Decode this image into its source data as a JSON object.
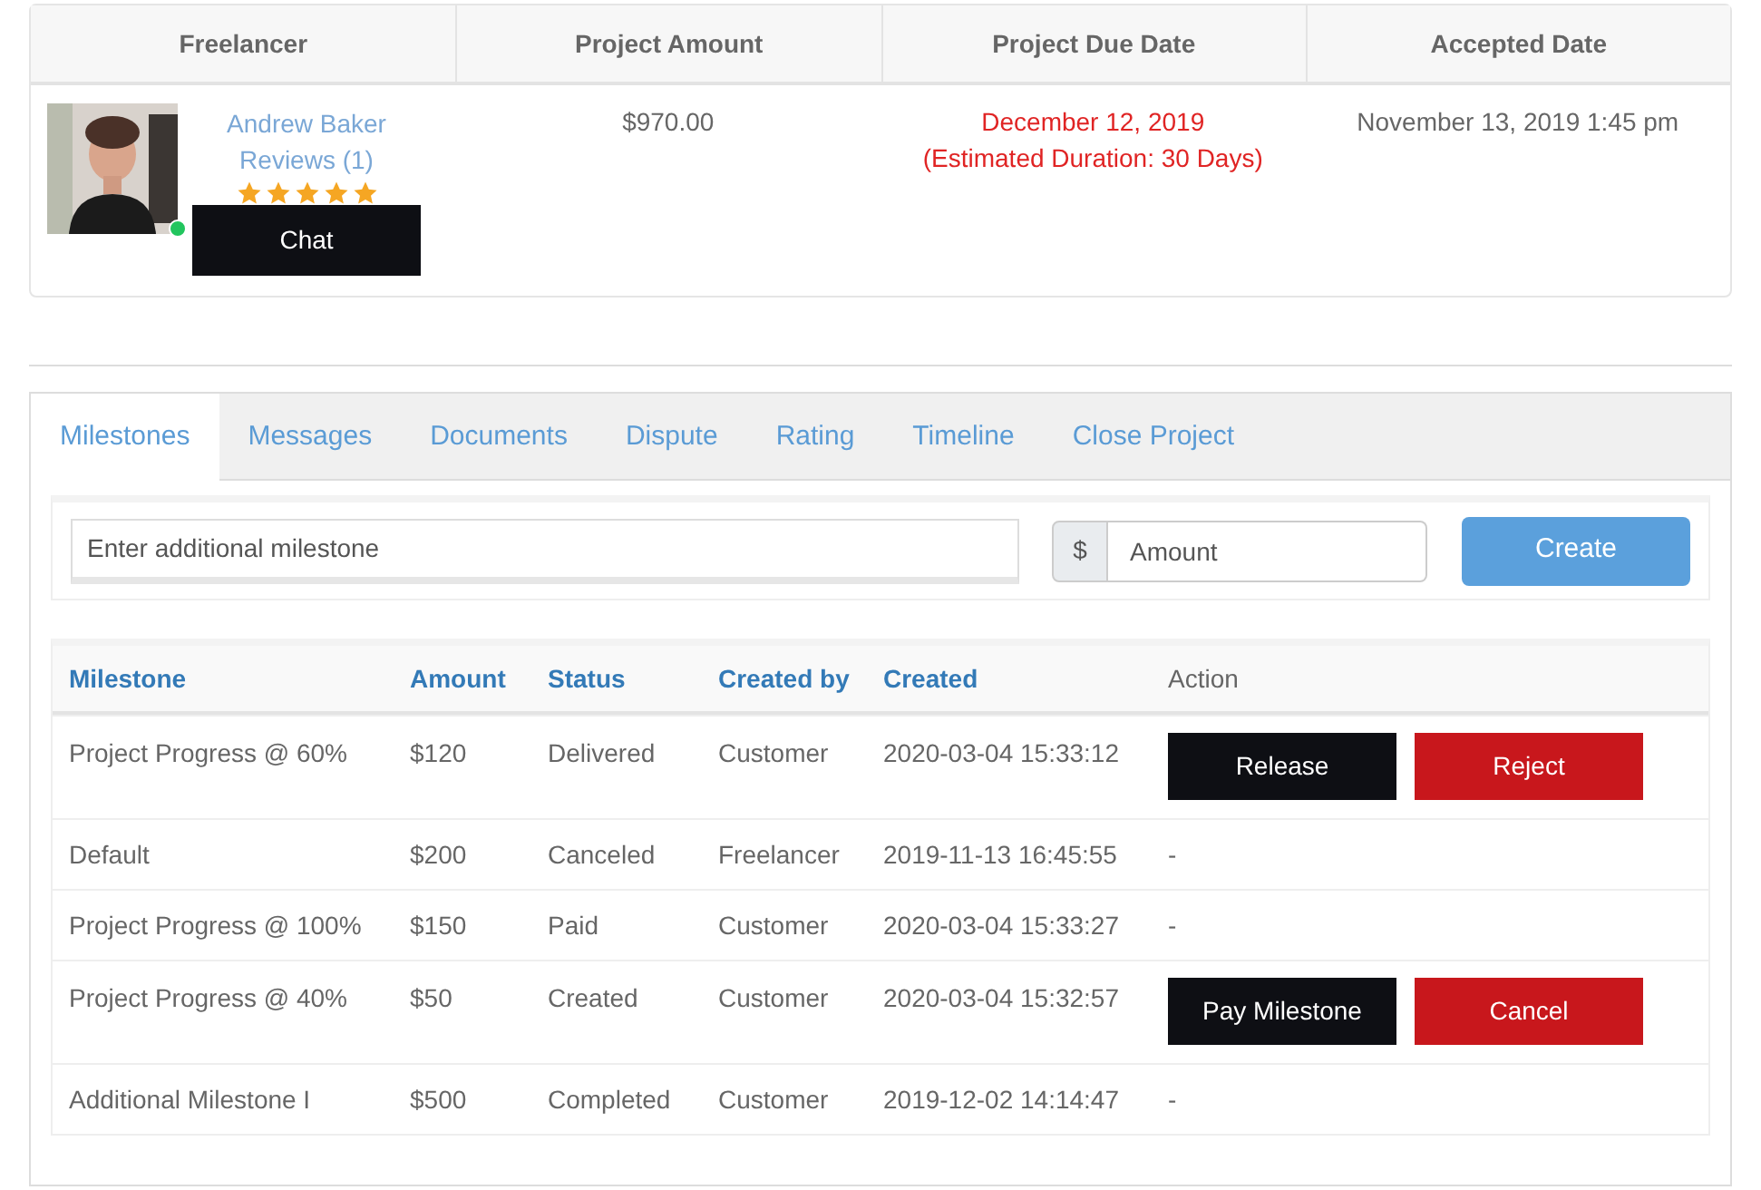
{
  "project": {
    "columns": [
      "Freelancer",
      "Project Amount",
      "Project Due Date",
      "Accepted Date"
    ],
    "freelancer": {
      "name": "Andrew Baker",
      "reviews": "Reviews (1)",
      "stars": 5,
      "online": true,
      "chat": "Chat"
    },
    "amount": "$970.00",
    "due_date": "December 12, 2019",
    "duration": "(Estimated Duration: 30 Days)",
    "accepted": "November 13, 2019 1:45 pm"
  },
  "tabs": [
    {
      "label": "Milestones",
      "selected": true
    },
    {
      "label": "Messages",
      "selected": false
    },
    {
      "label": "Documents",
      "selected": false
    },
    {
      "label": "Dispute",
      "selected": false
    },
    {
      "label": "Rating",
      "selected": false
    },
    {
      "label": "Timeline",
      "selected": false
    },
    {
      "label": "Close Project",
      "selected": false
    }
  ],
  "form": {
    "milestone_placeholder": "Enter additional milestone",
    "currency": "$",
    "amount_placeholder": "Amount",
    "button": "Create"
  },
  "table": {
    "columns": [
      {
        "label": "Milestone",
        "sortable": true
      },
      {
        "label": "Amount",
        "sortable": true
      },
      {
        "label": "Status",
        "sortable": true
      },
      {
        "label": "Created by",
        "sortable": true
      },
      {
        "label": "Created",
        "sortable": true
      },
      {
        "label": "Action",
        "sortable": false
      }
    ],
    "rows": [
      {
        "cells": [
          "Project Progress @ 60%",
          "$120",
          "Delivered",
          "Customer",
          "2020-03-04 15:33:12"
        ],
        "actions": [
          {
            "label": "Release",
            "kind": "dark"
          },
          {
            "label": "Reject",
            "kind": "danger"
          }
        ]
      },
      {
        "cells": [
          "Default",
          "$200",
          "Canceled",
          "Freelancer",
          "2019-11-13 16:45:55"
        ],
        "action_text": "-"
      },
      {
        "cells": [
          "Project Progress @ 100%",
          "$150",
          "Paid",
          "Customer",
          "2020-03-04 15:33:27"
        ],
        "action_text": "-"
      },
      {
        "cells": [
          "Project Progress @ 40%",
          "$50",
          "Created",
          "Customer",
          "2020-03-04 15:32:57"
        ],
        "actions": [
          {
            "label": "Pay Milestone",
            "kind": "dark"
          },
          {
            "label": "Cancel",
            "kind": "danger"
          }
        ]
      },
      {
        "cells": [
          "Additional Milestone I",
          "$500",
          "Completed",
          "Customer",
          "2019-12-02 14:14:47"
        ],
        "action_text": "-"
      }
    ]
  }
}
